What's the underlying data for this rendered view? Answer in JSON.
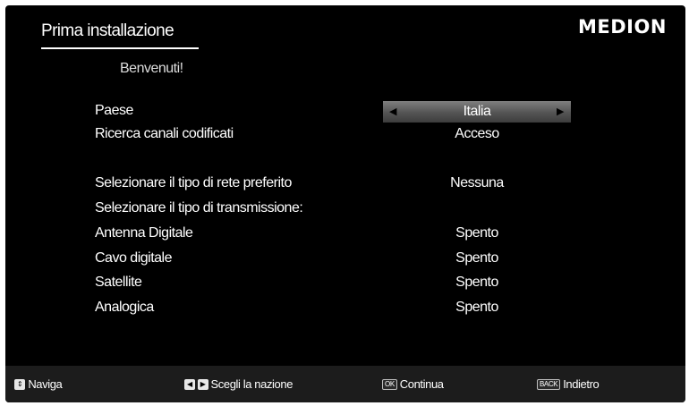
{
  "header": {
    "title": "Prima installazione",
    "logo": "MEDION"
  },
  "welcome": "Benvenuti!",
  "settings": [
    {
      "label": "Paese",
      "value": "Italia",
      "selected": true
    },
    {
      "label": "Ricerca canali codificati",
      "value": "Acceso"
    },
    {
      "label": "Selezionare il tipo di rete preferito",
      "value": "Nessuna"
    },
    {
      "label": "Selezionare il tipo di transmissione:",
      "value": ""
    },
    {
      "label": "Antenna Digitale",
      "value": "Spento"
    },
    {
      "label": "Cavo digitale",
      "value": "Spento"
    },
    {
      "label": "Satellite",
      "value": "Spento"
    },
    {
      "label": "Analogica",
      "value": "Spento"
    }
  ],
  "footer": {
    "navigate": {
      "key": "⇕",
      "label": "Naviga"
    },
    "choose_country": {
      "key_left": "◀",
      "key_right": "▶",
      "label": "Scegli la nazione"
    },
    "continue": {
      "key": "OK",
      "label": "Continua"
    },
    "back": {
      "key": "BACK",
      "label": "Indietro"
    }
  },
  "icons": {
    "arrow_left": "◀",
    "arrow_right": "▶"
  },
  "colors": {
    "background": "#000000",
    "footer": "#1c1c1c",
    "selected_gradient_top": "#7f7f7f",
    "selected_gradient_bottom": "#3d3d3d"
  }
}
